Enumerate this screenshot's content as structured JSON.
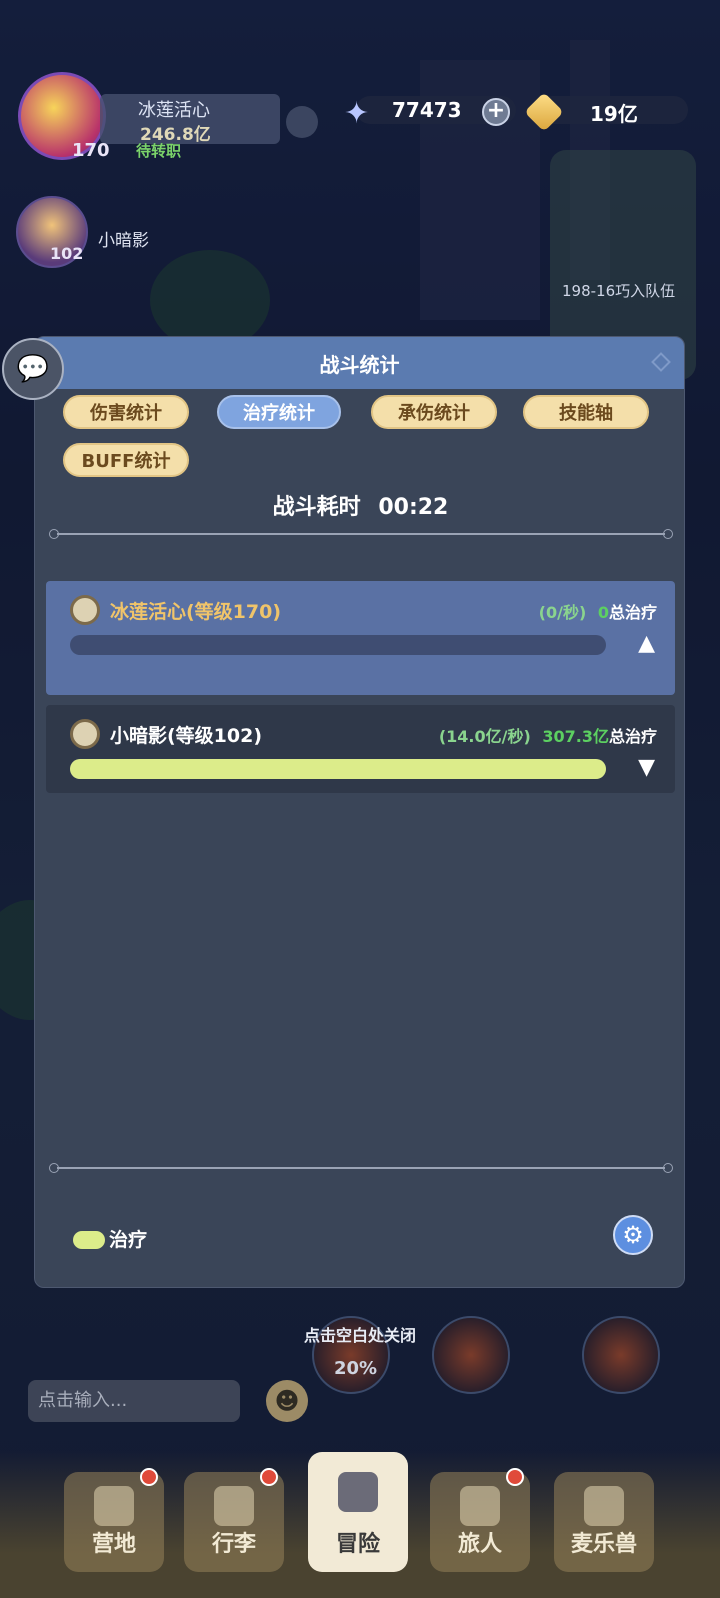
{
  "hud": {
    "hero1": {
      "name": "冰莲活心",
      "power": "246.8亿",
      "level": "170",
      "status": "待转职"
    },
    "hero2": {
      "name": "小暗影",
      "level": "102"
    },
    "stones": "77473",
    "gold": "19亿",
    "side_text": "198-16巧入队伍"
  },
  "modal": {
    "title": "战斗统计",
    "tabs": [
      {
        "label": "伤害统计",
        "active": false
      },
      {
        "label": "治疗统计",
        "active": true
      },
      {
        "label": "承伤统计",
        "active": false
      },
      {
        "label": "技能轴",
        "active": false
      },
      {
        "label": "BUFF统计",
        "active": false
      }
    ],
    "duration_label": "战斗耗时",
    "duration_value": "00:22",
    "rows": [
      {
        "name": "冰莲活心(等级170)",
        "rate": "(0/秒)",
        "total": "0",
        "total_label": "总治疗",
        "fill": 0,
        "expanded": true
      },
      {
        "name": "小暗影(等级102)",
        "rate": "(14.0亿/秒)",
        "total": "307.3亿",
        "total_label": "总治疗",
        "fill": 1.0,
        "expanded": false
      }
    ],
    "legend_label": "治疗"
  },
  "close_hint": "点击空白处关闭",
  "chat_placeholder": "点击输入...",
  "skill_percent": "20%",
  "nav": [
    {
      "label": "营地",
      "badge": true,
      "active": false
    },
    {
      "label": "行李",
      "badge": true,
      "active": false
    },
    {
      "label": "冒险",
      "badge": false,
      "active": true
    },
    {
      "label": "旅人",
      "badge": true,
      "active": false
    },
    {
      "label": "麦乐兽",
      "badge": false,
      "active": false
    }
  ],
  "colors": {
    "header": "#5b7bb0",
    "bar_fill": "#dcec8a",
    "total_green": "#5cd061",
    "name_gold": "#f0c46a"
  }
}
